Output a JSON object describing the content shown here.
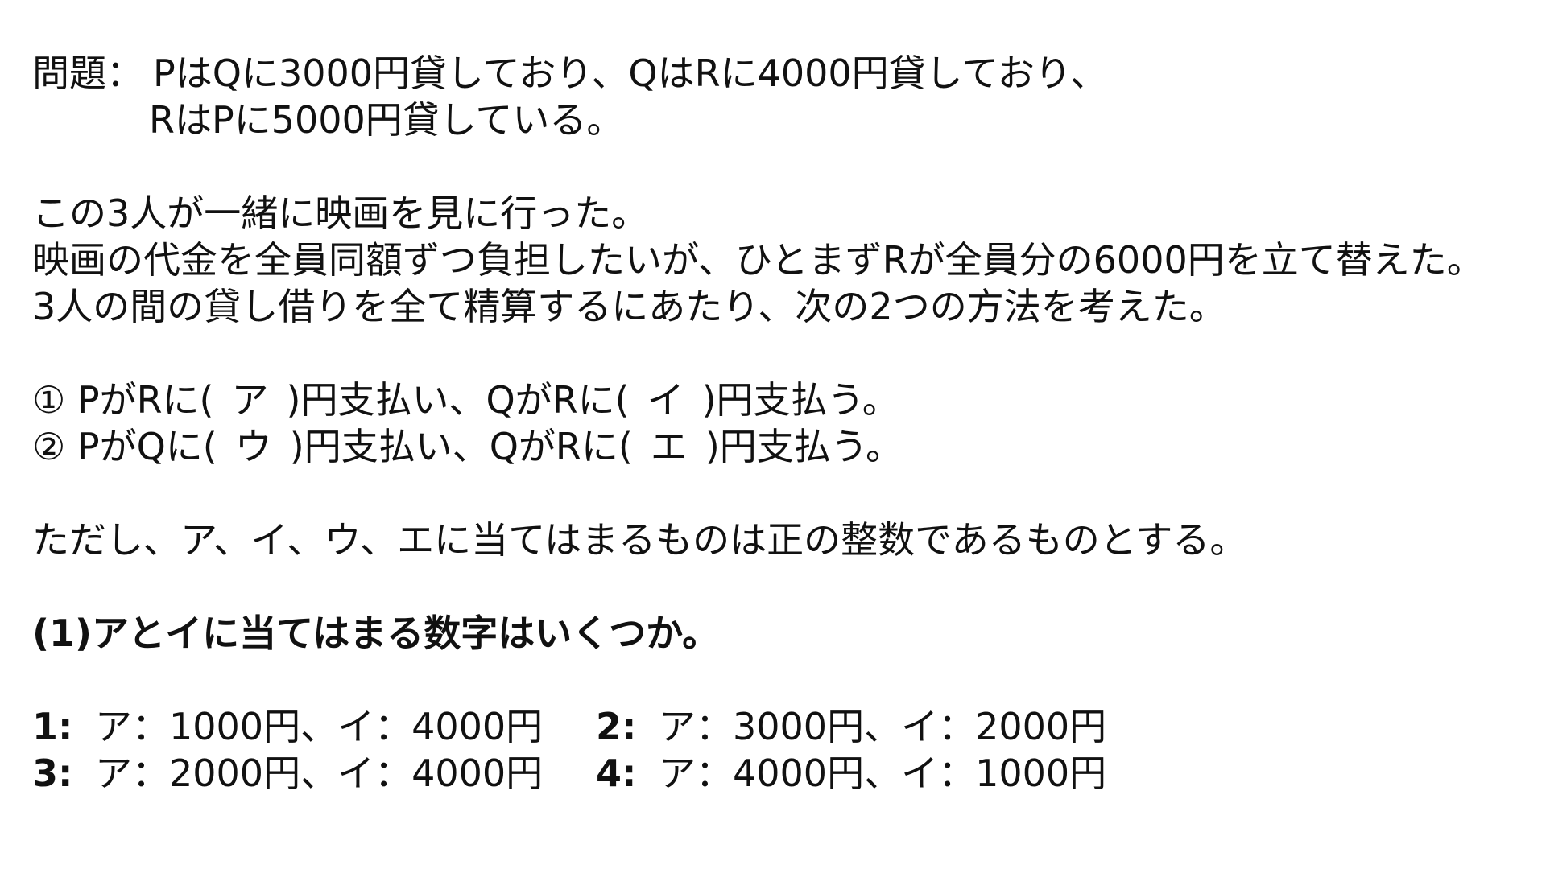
{
  "problem": {
    "label": "問題：",
    "line1": "PはQに3000円貸しており、QはRに4000円貸しており、",
    "line2": "RはPに5000円貸している。"
  },
  "story": {
    "line1": "この3人が一緒に映画を見に行った。",
    "line2": "映画の代金を全員同額ずつ負担したいが、ひとまずRが全員分の6000円を立て替えた。",
    "line3": "3人の間の貸し借りを全て精算するにあたり、次の2つの方法を考えた。"
  },
  "methods": [
    {
      "pre": "① PがRに(",
      "blank": "ア",
      "mid": ")円支払い、QがRに(",
      "blank2": "イ",
      "post": ")円支払う。"
    },
    {
      "pre": "② PがQに(",
      "blank": "ウ",
      "mid": ")円支払い、QがRに(",
      "blank2": "エ",
      "post": ")円支払う。"
    }
  ],
  "note": "ただし、ア、イ、ウ、エに当てはまるものは正の整数であるものとする。",
  "question": "(1)アとイに当てはまる数字はいくつか。",
  "choices": [
    {
      "num": "1:",
      "text": "ア：1000円、イ：4000円"
    },
    {
      "num": "2:",
      "text": "ア：3000円、イ：2000円"
    },
    {
      "num": "3:",
      "text": "ア：2000円、イ：4000円"
    },
    {
      "num": "4:",
      "text": "ア：4000円、イ：1000円"
    }
  ]
}
